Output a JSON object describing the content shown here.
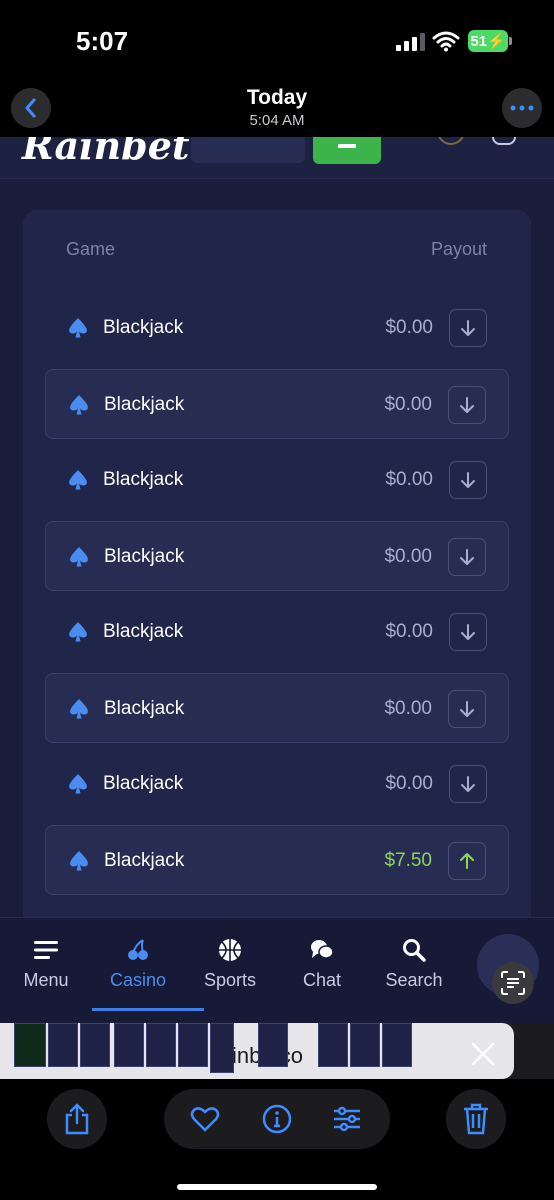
{
  "status_bar": {
    "time": "5:07",
    "battery": "51"
  },
  "photo_header": {
    "title": "Today",
    "subtitle": "5:04 AM"
  },
  "site": {
    "logo": "Rainbet"
  },
  "table": {
    "headers": {
      "game": "Game",
      "payout": "Payout"
    },
    "rows": [
      {
        "game": "Blackjack",
        "payout": "$0.00",
        "direction": "down",
        "win": false
      },
      {
        "game": "Blackjack",
        "payout": "$0.00",
        "direction": "down",
        "win": false
      },
      {
        "game": "Blackjack",
        "payout": "$0.00",
        "direction": "down",
        "win": false
      },
      {
        "game": "Blackjack",
        "payout": "$0.00",
        "direction": "down",
        "win": false
      },
      {
        "game": "Blackjack",
        "payout": "$0.00",
        "direction": "down",
        "win": false
      },
      {
        "game": "Blackjack",
        "payout": "$0.00",
        "direction": "down",
        "win": false
      },
      {
        "game": "Blackjack",
        "payout": "$0.00",
        "direction": "down",
        "win": false
      },
      {
        "game": "Blackjack",
        "payout": "$7.50",
        "direction": "up",
        "win": true
      }
    ]
  },
  "bottom_nav": {
    "items": [
      {
        "label": "Menu",
        "icon": "menu-icon"
      },
      {
        "label": "Casino",
        "icon": "cherries-icon",
        "active": true
      },
      {
        "label": "Sports",
        "icon": "basketball-icon"
      },
      {
        "label": "Chat",
        "icon": "chat-icon"
      },
      {
        "label": "Search",
        "icon": "search-icon"
      }
    ]
  },
  "thumbnail_strip": {
    "caption": "inbe co"
  },
  "colors": {
    "accent": "#4a8cf0",
    "win": "#8cd65a",
    "bg": "#1a1d3a",
    "card": "#20254a"
  }
}
